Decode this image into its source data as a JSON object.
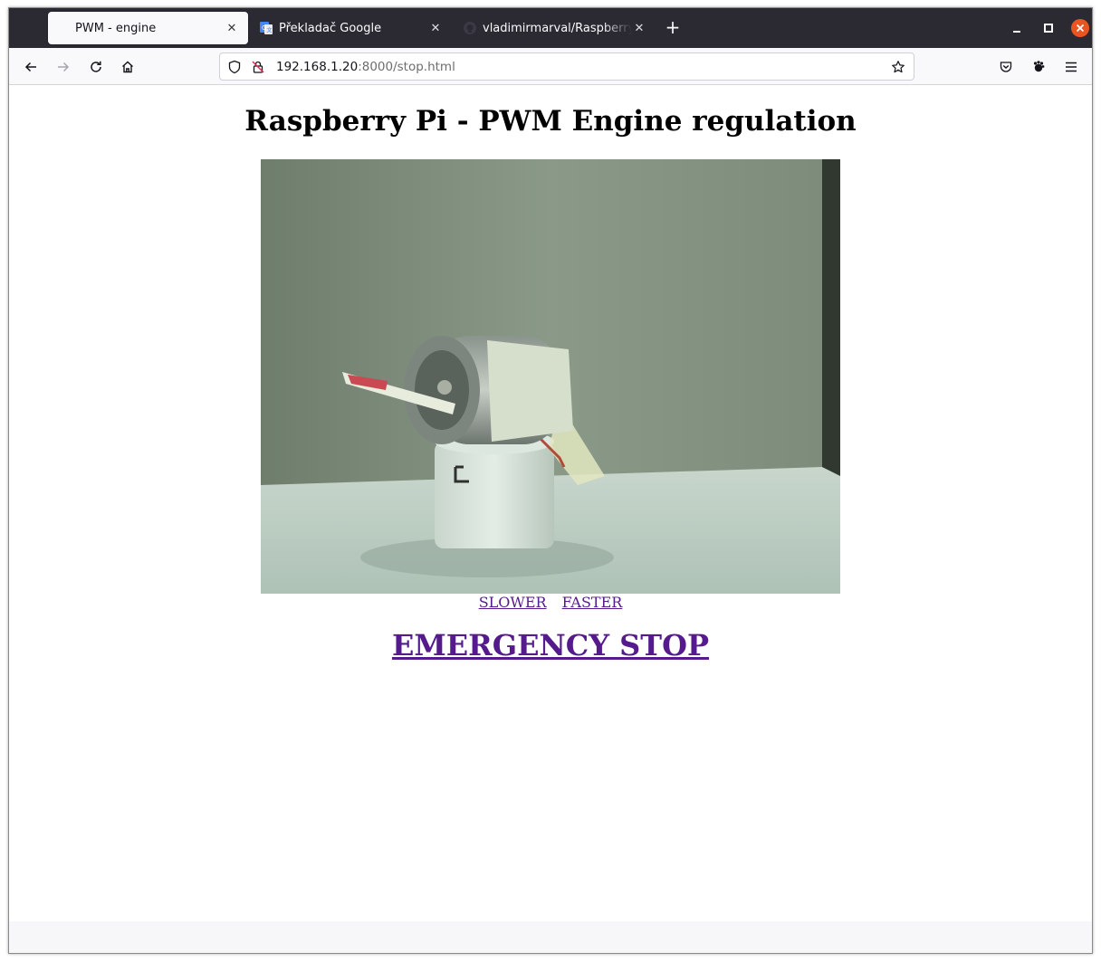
{
  "tabs": [
    {
      "title": "PWM - engine",
      "active": true
    },
    {
      "title": "Překladač Google",
      "active": false
    },
    {
      "title": "vladimirmarval/Raspberry-P",
      "active": false
    }
  ],
  "address": {
    "host": "192.168.1.20",
    "rest": ":8000/stop.html"
  },
  "page": {
    "heading": "Raspberry Pi - PWM Engine regulation",
    "slower_label": "SLOWER",
    "faster_label": "FASTER",
    "emergency_label": "EMERGENCY STOP"
  },
  "colors": {
    "link_visited": "#551a8b",
    "tabbar": "#2b2a33",
    "close_button": "#e95420"
  },
  "icons": [
    "back-arrow-icon",
    "forward-arrow-icon",
    "reload-icon",
    "home-icon",
    "shield-icon",
    "insecure-lock-icon",
    "bookmark-star-icon",
    "pocket-icon",
    "extension-icon",
    "menu-icon"
  ]
}
